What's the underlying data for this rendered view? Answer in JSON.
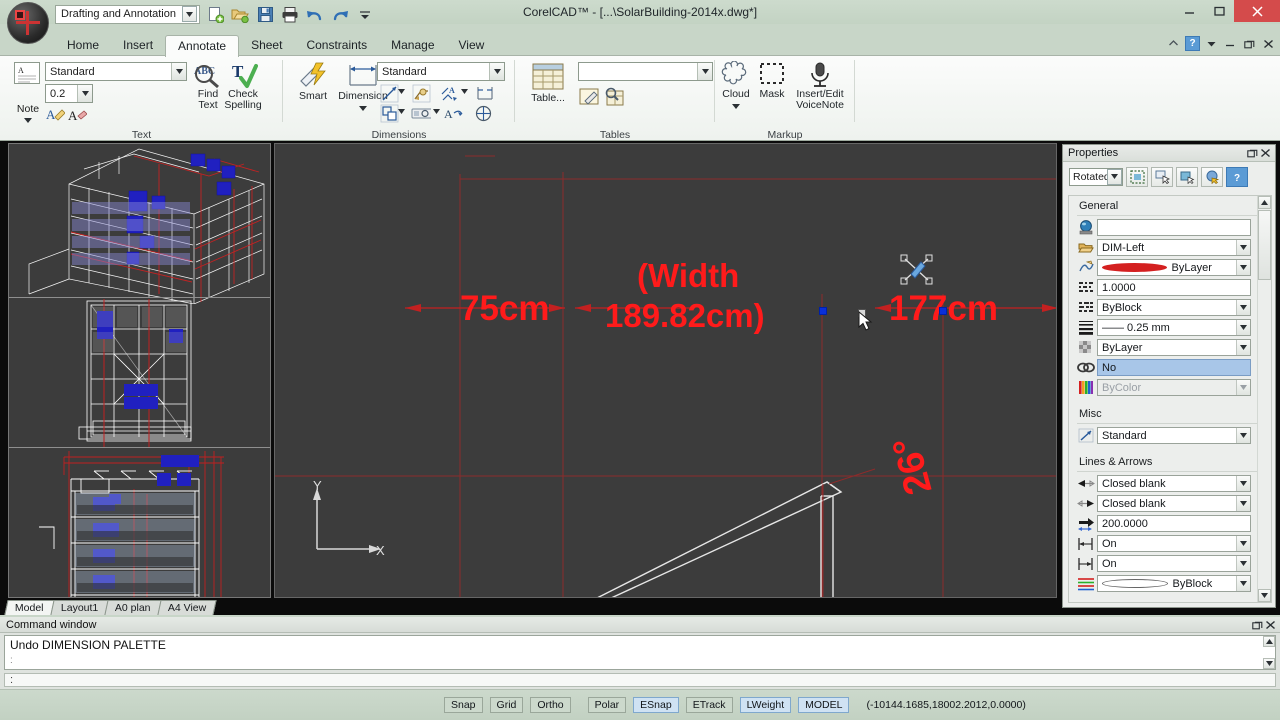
{
  "window": {
    "title": "CorelCAD™ - [...\\SolarBuilding-2014x.dwg*]",
    "minimize": "–",
    "maximize": "▢",
    "close": "✕"
  },
  "quick_access": {
    "workspace": "Drafting and Annotation",
    "icons": [
      "new-icon",
      "open-icon",
      "save-icon",
      "print-icon",
      "undo-icon",
      "redo-icon",
      "customize-icon"
    ]
  },
  "ribbon": {
    "tabs": [
      {
        "label": "Home",
        "active": false
      },
      {
        "label": "Insert",
        "active": false
      },
      {
        "label": "Annotate",
        "active": true
      },
      {
        "label": "Sheet",
        "active": false
      },
      {
        "label": "Constraints",
        "active": false
      },
      {
        "label": "Manage",
        "active": false
      },
      {
        "label": "View",
        "active": false
      }
    ],
    "right_buttons": [
      "collapse-ribbon-icon",
      "help-icon",
      "dropdown-icon",
      "minimize-icon",
      "restore-icon",
      "close-icon"
    ],
    "groups": [
      {
        "name": "Text",
        "title": "Text",
        "note_label": "Note",
        "style_value": "Standard",
        "size_value": "0.2",
        "find_text_label": "Find\nText",
        "find_text_line1": "Find",
        "find_text_line2": "Text",
        "check_spelling_line1": "Check",
        "check_spelling_line2": "Spelling"
      },
      {
        "name": "Dimensions",
        "title": "Dimensions",
        "smart_label": "Smart",
        "dimension_label": "Dimension",
        "style_value": "Standard"
      },
      {
        "name": "Tables",
        "title": "Tables",
        "table_label": "Table...",
        "style_value": ""
      },
      {
        "name": "Markup",
        "title": "Markup",
        "cloud_label": "Cloud",
        "mask_label": "Mask",
        "voicenote_line1": "Insert/Edit",
        "voicenote_line2": "VoiceNote"
      }
    ]
  },
  "workspace": {
    "layout_tabs": [
      {
        "label": "Model",
        "active": true
      },
      {
        "label": "Layout1",
        "active": false
      },
      {
        "label": "A0 plan",
        "active": false
      },
      {
        "label": "A4 View",
        "active": false
      }
    ],
    "ucs": {
      "x_label": "X",
      "y_label": "Y"
    },
    "annotations": [
      {
        "name": "dim-75cm",
        "text": "75cm"
      },
      {
        "name": "dim-width-line1",
        "text": "(Width"
      },
      {
        "name": "dim-width-line2",
        "text": "189.82cm)"
      },
      {
        "name": "dim-177cm",
        "text": "177cm"
      },
      {
        "name": "dim-angle",
        "text": "26°"
      }
    ]
  },
  "properties": {
    "title": "Properties",
    "header_buttons": [
      "undock-icon",
      "close-icon"
    ],
    "selection_type": "Rotated",
    "toolbar_icons": [
      "quick-select-icon",
      "pick-add-icon",
      "select-similar-icon",
      "toggle-value-icon",
      "help-icon"
    ],
    "sections": [
      {
        "title": "General",
        "rows": [
          {
            "icon": "color-sphere-icon",
            "value": "",
            "type": "text",
            "state": "normal"
          },
          {
            "icon": "layer-icon",
            "value": "DIM-Left",
            "type": "combo",
            "state": "normal"
          },
          {
            "icon": "linetype-icon",
            "value": "ByLayer",
            "type": "combo",
            "state": "normal",
            "swatch": "#d42020"
          },
          {
            "icon": "linetype-scale-icon",
            "value": "1.0000",
            "type": "text",
            "state": "normal"
          },
          {
            "icon": "lineweight-dots-icon",
            "value": "ByBlock",
            "type": "combo",
            "state": "normal"
          },
          {
            "icon": "lineweight-icon",
            "value": "—— 0.25 mm",
            "type": "combo",
            "state": "normal"
          },
          {
            "icon": "transparency-icon",
            "value": "ByLayer",
            "type": "combo",
            "state": "normal"
          },
          {
            "icon": "hyperlink-icon",
            "value": "No",
            "type": "text",
            "state": "selected"
          },
          {
            "icon": "color-bars-icon",
            "value": "ByColor",
            "type": "combo",
            "state": "disabled"
          }
        ]
      },
      {
        "title": "Misc",
        "rows": [
          {
            "icon": "dimension-style-icon",
            "value": "Standard",
            "type": "combo",
            "state": "normal"
          }
        ]
      },
      {
        "title": "Lines & Arrows",
        "rows": [
          {
            "icon": "arrow-start-icon",
            "value": "Closed blank",
            "type": "combo",
            "state": "normal"
          },
          {
            "icon": "arrow-end-icon",
            "value": "Closed blank",
            "type": "combo",
            "state": "normal"
          },
          {
            "icon": "arrow-size-icon",
            "value": "200.0000",
            "type": "text",
            "state": "normal"
          },
          {
            "icon": "ext-line-1-icon",
            "value": "On",
            "type": "combo",
            "state": "normal"
          },
          {
            "icon": "ext-line-2-icon",
            "value": "On",
            "type": "combo",
            "state": "normal"
          },
          {
            "icon": "dim-line-color-icon",
            "value": "ByBlock",
            "type": "combo",
            "state": "normal",
            "swatch": "#ffffff"
          }
        ]
      }
    ]
  },
  "command_window": {
    "title": "Command window",
    "history": "Undo DIMENSION PALETTE",
    "prompt": ":",
    "input": ":"
  },
  "status_bar": {
    "buttons": [
      {
        "label": "Snap",
        "active": false
      },
      {
        "label": "Grid",
        "active": false
      },
      {
        "label": "Ortho",
        "active": false
      },
      {
        "label": "Polar",
        "active": false
      },
      {
        "label": "ESnap",
        "active": true
      },
      {
        "label": "ETrack",
        "active": false
      },
      {
        "label": "LWeight",
        "active": true
      },
      {
        "label": "MODEL",
        "active": true
      }
    ],
    "coordinates": "(-10144.1685,18002.2012,0.0000)"
  },
  "colors": {
    "chrome": "#c8d6c8",
    "canvas": "#3c3c3c",
    "dimension_red": "#ff1b1b",
    "accent_blue": "#5b9bd5",
    "selected_row": "#a8c6e8"
  }
}
